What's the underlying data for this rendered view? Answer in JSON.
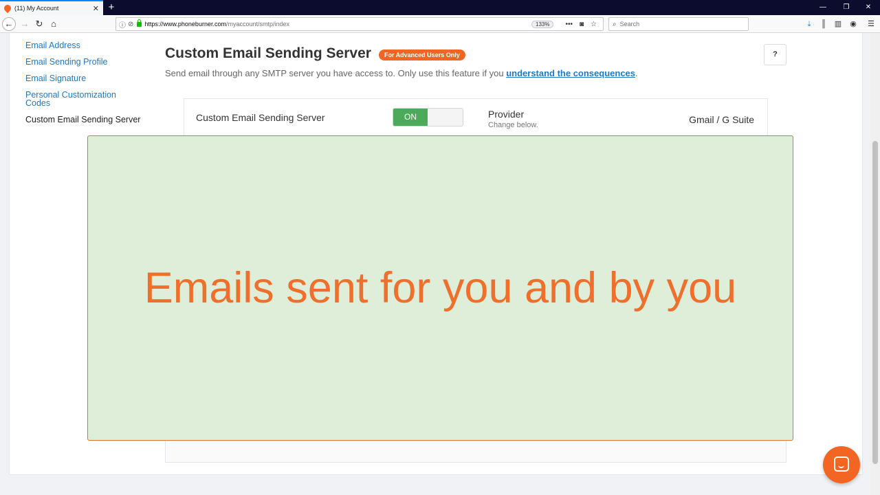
{
  "browser": {
    "tab_title": "(11) My Account",
    "tab_close": "✕",
    "new_tab": "+",
    "url_host": "https://www.phoneburner.com",
    "url_path": "/myaccount/smtp/index",
    "zoom": "133%",
    "search_placeholder": "Search",
    "window_controls": [
      "—",
      "❐",
      "✕"
    ]
  },
  "sidebar": {
    "items": [
      {
        "label": "Email Address"
      },
      {
        "label": "Email Sending Profile"
      },
      {
        "label": "Email Signature"
      },
      {
        "label": "Personal Customization Codes"
      },
      {
        "label": "Custom Email Sending Server"
      }
    ]
  },
  "header": {
    "title": "Custom Email Sending Server",
    "badge": "For Advanced Users Only",
    "help": "?",
    "subtitle_prefix": "Send email through any SMTP server you have access to. Only use this feature if you ",
    "subtitle_link": "understand the consequences",
    "subtitle_suffix": "."
  },
  "server_card": {
    "label": "Custom Email Sending Server",
    "toggle_state": "ON",
    "provider_label": "Provider",
    "provider_hint": "Change below.",
    "provider_value": "Gmail / G Suite"
  },
  "overlay": {
    "caption": "Emails sent for you and by you"
  },
  "colors": {
    "brand_orange": "#f26522",
    "toggle_green": "#4caa5a",
    "link_blue": "#1f79c2",
    "overlay_bg": "#dfeed9"
  }
}
